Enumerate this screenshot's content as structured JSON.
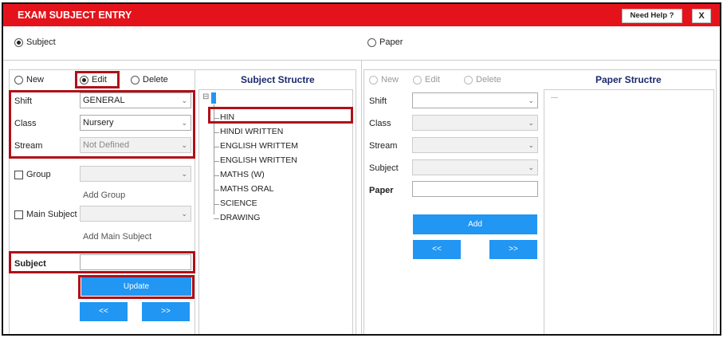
{
  "window": {
    "title": "EXAM SUBJECT ENTRY",
    "help_label": "Need Help ?",
    "close_label": "X"
  },
  "mode": {
    "subject_label": "Subject",
    "paper_label": "Paper",
    "selected": "Subject"
  },
  "subject_form": {
    "actions": {
      "new_label": "New",
      "edit_label": "Edit",
      "delete_label": "Delete",
      "selected": "Edit"
    },
    "shift_label": "Shift",
    "shift_value": "GENERAL",
    "class_label": "Class",
    "class_value": "Nursery",
    "stream_label": "Stream",
    "stream_value": "Not Defined",
    "group_label": "Group",
    "add_group_label": "Add Group",
    "main_subject_label": "Main Subject",
    "add_main_subject_label": "Add Main Subject",
    "subject_label": "Subject",
    "subject_value": "",
    "update_label": "Update",
    "prev_label": "<<",
    "next_label": ">>"
  },
  "subject_structure": {
    "title": "Subject Structre",
    "toggle": "⊟",
    "items": [
      "HIN",
      "HINDI WRITTEN",
      "ENGLISH WRITTEM",
      "ENGLISH WRITTEN",
      "MATHS (W)",
      "MATHS ORAL",
      "SCIENCE",
      "DRAWING"
    ]
  },
  "paper_form": {
    "actions": {
      "new_label": "New",
      "edit_label": "Edit",
      "delete_label": "Delete"
    },
    "shift_label": "Shift",
    "class_label": "Class",
    "stream_label": "Stream",
    "subject_label": "Subject",
    "paper_label": "Paper",
    "add_label": "Add",
    "prev_label": "<<",
    "next_label": ">>"
  },
  "paper_structure": {
    "title": "Paper Structre",
    "placeholder": "---"
  },
  "colors": {
    "titlebar": "#e4131b",
    "button": "#2196f3",
    "highlight": "#b01018",
    "structure_title": "#1a2a6e"
  }
}
